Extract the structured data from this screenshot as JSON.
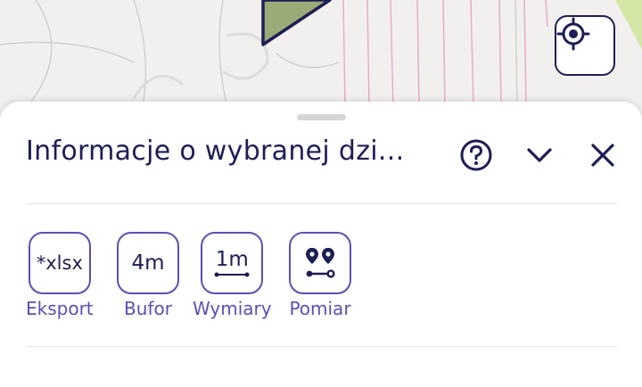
{
  "map": {
    "locate_icon": "crosshair-icon",
    "colors": {
      "parcel_fill": "#9aab78",
      "parcel_outline": "#1f1d55",
      "parcel_lines": "#e8a6c8",
      "road": "#d4e6a6"
    }
  },
  "panel": {
    "title": "Informacje o wybranej dzi...",
    "icons": [
      "help-circle-icon",
      "chevron-down-icon",
      "close-icon"
    ]
  },
  "tools": [
    {
      "icon_text": "*xlsx",
      "label": "Eksport"
    },
    {
      "icon_text": "4m",
      "label": "Bufor"
    },
    {
      "icon_text": "1m",
      "label": "Wymiary"
    },
    {
      "icon": "measure-pins-icon",
      "label": "Pomiar"
    }
  ],
  "colors": {
    "primary": "#1f1d55",
    "accent": "#5b4fb5"
  }
}
